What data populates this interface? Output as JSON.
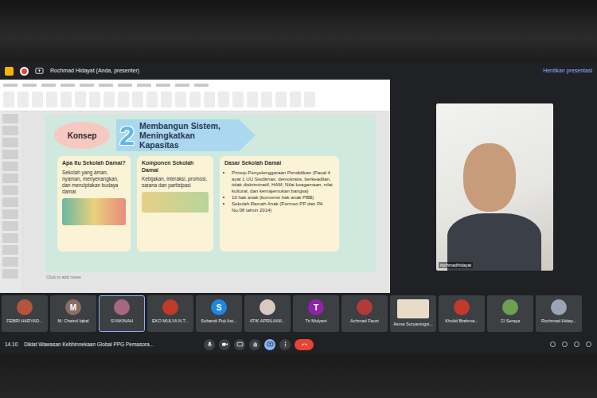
{
  "meet": {
    "presenter_label": "Rochmad Hidayat (Anda, presenter)",
    "stop_button": "Hentikan presentasi"
  },
  "slide": {
    "label": "Konsep",
    "number": "2",
    "title": "Membangun Sistem, Meningkatkan Kapasitas",
    "cards": [
      {
        "title": "Apa Itu Sekolah Damai?",
        "body": "Sekolah yang aman, nyaman, menyenangkan, dan menciptakan budaya damai",
        "bullets": []
      },
      {
        "title": "Komponen Sekolah Damai",
        "body": "Kebijakan, interaksi, promosi, sarana dan partisipasi",
        "bullets": []
      },
      {
        "title": "Dasar Sekolah Damai",
        "body": "",
        "bullets": [
          "Prinsip Penyelenggaraan Pendidikan (Pasal 4 ayat 1 UU Sisdiknas: demokratis, berkeadilan, tidak diskriminatif, HAM, Nilai keagamaan, nilai kultural, dan kemajemukan bangsa)",
          "10 hak anak (konvensi hak anak PBB)",
          "Sekolah Ramah Anak (Permen PP dan PA No.08 tahun 2014)"
        ]
      }
    ],
    "notes": "Click to add notes"
  },
  "self_view": {
    "label": "rochmadhidayat"
  },
  "participants": [
    {
      "name": "FEBRI HARYAD...",
      "avatar": "",
      "kind": "photo",
      "color": "#b5533c",
      "selected": false
    },
    {
      "name": "M. Chairul Iqbal",
      "avatar": "M",
      "kind": "letter",
      "color": "#8d6e63",
      "selected": false
    },
    {
      "name": "SYAKINAH",
      "avatar": "",
      "kind": "photo",
      "color": "#a9677f",
      "selected": true
    },
    {
      "name": "EKO MULYA N.T...",
      "avatar": "",
      "kind": "photo",
      "color": "#c0392b",
      "selected": false
    },
    {
      "name": "Subandi Puji Ast...",
      "avatar": "S",
      "kind": "letter",
      "color": "#1e88e5",
      "selected": false
    },
    {
      "name": "ATIK APRILIANI...",
      "avatar": "",
      "kind": "photo",
      "color": "#d7c9c0",
      "selected": false
    },
    {
      "name": "Tri Mulyani",
      "avatar": "T",
      "kind": "letter",
      "color": "#8e24aa",
      "selected": false
    },
    {
      "name": "Achmad Fauzi",
      "avatar": "",
      "kind": "photo",
      "color": "#b23a3a",
      "selected": false
    },
    {
      "name": "Asma Suryaningsi...",
      "avatar": "",
      "kind": "video",
      "color": "#e8dcc8",
      "selected": false
    },
    {
      "name": "Kholid Brahma...",
      "avatar": "",
      "kind": "photo",
      "color": "#c0392b",
      "selected": false
    },
    {
      "name": "CI Seraya",
      "avatar": "",
      "kind": "photo",
      "color": "#6d9f55",
      "selected": false
    },
    {
      "name": "Rochmad Hiday...",
      "avatar": "",
      "kind": "photo",
      "color": "#9aa4b5",
      "selected": false
    }
  ],
  "bottom": {
    "time": "14.10",
    "title": "Diklat Wawasan Kebhinnekaan Global PPG Pemasora..."
  },
  "controls": [
    {
      "kind": "mic",
      "active": false
    },
    {
      "kind": "camera",
      "active": false
    },
    {
      "kind": "captions",
      "active": false
    },
    {
      "kind": "hand",
      "active": false
    },
    {
      "kind": "present",
      "active": true
    },
    {
      "kind": "more",
      "active": false
    },
    {
      "kind": "hangup",
      "active": false
    }
  ]
}
